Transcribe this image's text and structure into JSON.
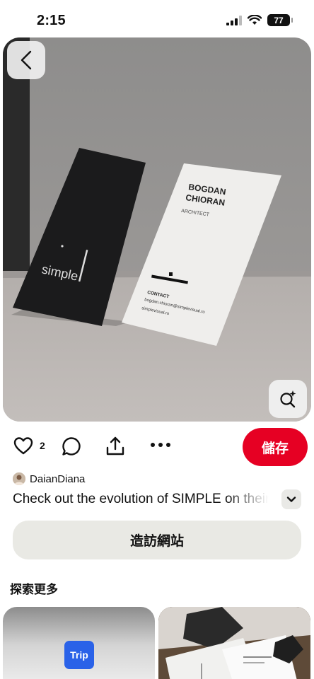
{
  "status_bar": {
    "time": "2:15",
    "battery": "77"
  },
  "pin": {
    "card_dark_text": "simple",
    "card_light_name": "BOGDAN CHIORAN",
    "card_light_title": "ARCHITECT",
    "card_light_contact_label": "CONTACT",
    "card_light_email": "bogdan.chioran@simplevisual.ro",
    "card_light_site": "simplevisual.ro"
  },
  "actions": {
    "like_count": "2",
    "save_label": "儲存"
  },
  "author": {
    "name": "DaianDiana"
  },
  "caption": "Check out the evolution of SIMPLE on their b",
  "visit_label": "造訪網站",
  "explore": {
    "title": "探索更多",
    "cards": [
      {
        "logo_text": "Trip"
      }
    ]
  },
  "colors": {
    "save_red": "#e60023",
    "visit_bg": "#e9e9e4"
  },
  "icons": [
    "chevron-left-icon",
    "visual-search-icon",
    "heart-icon",
    "comment-icon",
    "share-icon",
    "more-icon",
    "chevron-down-icon"
  ]
}
